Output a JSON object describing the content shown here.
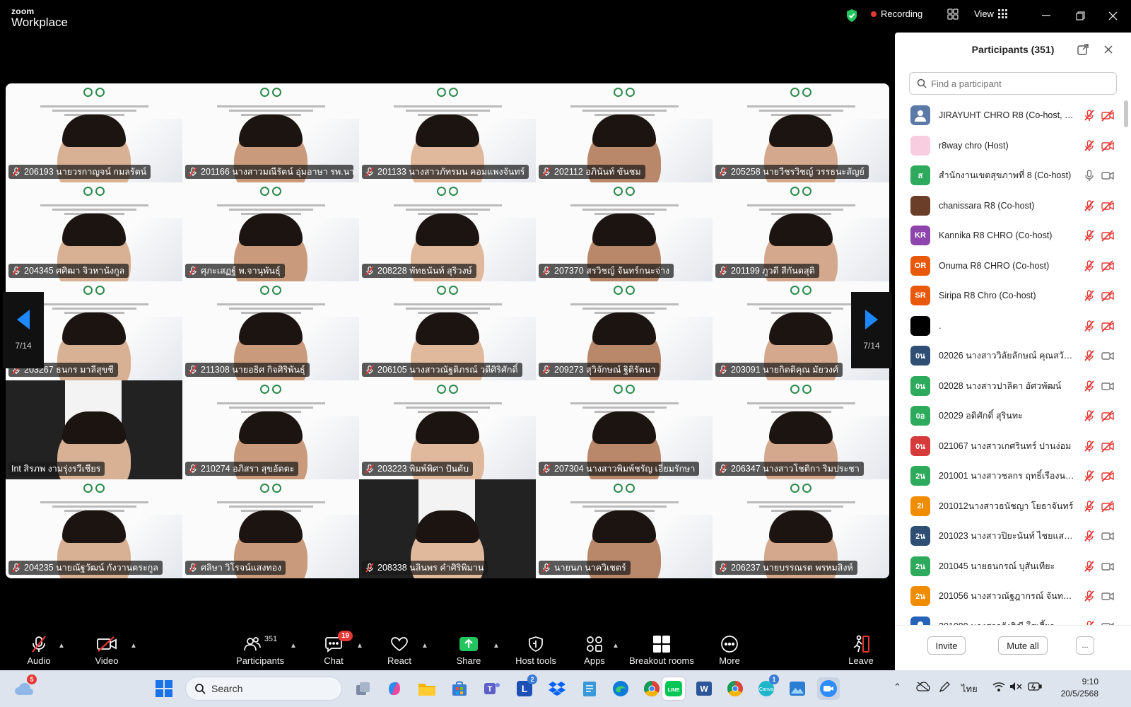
{
  "titlebar": {
    "brand_line1": "zoom",
    "brand_line2": "Workplace",
    "recording_label": "Recording",
    "view_label": "View"
  },
  "gallery": {
    "page_left": "7/14",
    "page_right": "7/14",
    "tiles": [
      {
        "name": "206193 นายวรกาญจน์ กมลรัตน์",
        "muted": true
      },
      {
        "name": "201166 นางสาวมณีรัตน์ อุ่มอาษา รพ.นา...",
        "muted": true
      },
      {
        "name": "201133 นางสาวภัทรมน คอมแพงจันทร์",
        "muted": true
      },
      {
        "name": "202112 อภินันท์ ขันชม",
        "muted": true
      },
      {
        "name": "205258 นายวีชรวิชญ์ วรรธนะสัญย์",
        "muted": true
      },
      {
        "name": "204345 ศศิฒา จิวหานังกูล",
        "muted": true
      },
      {
        "name": "ศุภะเสฏฐ์ พ.จานุพันธุ์",
        "muted": true
      },
      {
        "name": "208228 พัทธนันท์ สุริวงษ์",
        "muted": true
      },
      {
        "name": "207370 สรวิชญ์ จันทร์กนะจ่าง",
        "muted": true
      },
      {
        "name": "201199 ภูวดี สีกันดสุติ",
        "muted": true
      },
      {
        "name": "203267 ธนกร มาลีสุขชี",
        "muted": true
      },
      {
        "name": "211308 นายอธิศ กิจศิริพันธุ์",
        "muted": true
      },
      {
        "name": "206105 นางสาวณัฐติภรณ์ วดีศิริศักดิ์",
        "muted": true
      },
      {
        "name": "209273 สุวิจักษณ์ ฐิติรัตนา",
        "muted": true
      },
      {
        "name": "203091 นายกิตติคุณ มัยวงศ์",
        "muted": true
      },
      {
        "name": "Int สิรภพ งามรุ่งรวีเชียร",
        "muted": false
      },
      {
        "name": "210274 อภิสรา สุขอัตตะ",
        "muted": true
      },
      {
        "name": "203223 พิมพ์พิศา ปันตับ",
        "muted": true
      },
      {
        "name": "207304 นางสาวพิมพ์ชรัญ เอี่ยมรักษา",
        "muted": true
      },
      {
        "name": "206347 นางสาวโชติกา ริมประชา",
        "muted": true
      },
      {
        "name": "204235 นายณัฐวัฒน์ กังวานตระกูล",
        "muted": true
      },
      {
        "name": "ศลิษา วิโรจน์แสงทอง",
        "muted": true
      },
      {
        "name": "208338 นลินพร คำศิริพิมาน",
        "muted": true
      },
      {
        "name": "นายนภ นาควิเชตร์",
        "muted": true
      },
      {
        "name": "206237 นายบรรณรต พรหมสิงห์",
        "muted": true
      }
    ]
  },
  "toolbar": {
    "audio": "Audio",
    "video": "Video",
    "participants": "Participants",
    "participants_count": "351",
    "chat": "Chat",
    "chat_badge": "19",
    "react": "React",
    "share": "Share",
    "host_tools": "Host tools",
    "apps": "Apps",
    "breakout": "Breakout rooms",
    "more": "More",
    "leave": "Leave"
  },
  "panel": {
    "title": "Participants (351)",
    "search_placeholder": "Find a participant",
    "invite": "Invite",
    "mute_all": "Mute all",
    "more": "...",
    "participants": [
      {
        "initials": "",
        "name": "JIRAYUHT CHRO R8 (Co-host, me)",
        "color": "#5c7aa8",
        "mic": "off",
        "video": "off"
      },
      {
        "initials": "",
        "name": "r8way chro (Host)",
        "color": "#f9cde0",
        "mic": "off",
        "video": "off"
      },
      {
        "initials": "ส",
        "name": "สำนักงานเขตสุขภาพที่ 8 (Co-host)",
        "color": "#2eaa5c",
        "mic": "on",
        "video": "on"
      },
      {
        "initials": "",
        "name": "chanissara R8 (Co-host)",
        "color": "#6b3e2a",
        "mic": "off",
        "video": "off"
      },
      {
        "initials": "KR",
        "name": "Kannika R8 CHRO (Co-host)",
        "color": "#8e44ad",
        "mic": "off",
        "video": "off"
      },
      {
        "initials": "OR",
        "name": "Onuma R8 CHRO (Co-host)",
        "color": "#e8590c",
        "mic": "off",
        "video": "off"
      },
      {
        "initials": "SR",
        "name": "Siripa R8 Chro (Co-host)",
        "color": "#e8590c",
        "mic": "off",
        "video": "off"
      },
      {
        "initials": "",
        "name": ".",
        "color": "#000000",
        "mic": "off",
        "video": "off"
      },
      {
        "initials": "0น",
        "name": "02026 นางสาววิลัยลักษณ์ คุณสวัสดิ...",
        "color": "#2f4e73",
        "mic": "off",
        "video": "on"
      },
      {
        "initials": "0น",
        "name": "02028 นางสาวปาลิดา อัศวพัฒน์",
        "color": "#2eaa5c",
        "mic": "off",
        "video": "on"
      },
      {
        "initials": "0อ",
        "name": "02029 อดิศักดิ์ สุรินทะ",
        "color": "#2eaa5c",
        "mic": "off",
        "video": "off"
      },
      {
        "initials": "0น",
        "name": "021067 นางสาวเกศรินทร์ ปานง่อม",
        "color": "#d63a3a",
        "mic": "off",
        "video": "off"
      },
      {
        "initials": "2น",
        "name": "201001 นางสาวชลกร ฤทธิ์เรืองนาม",
        "color": "#2eaa5c",
        "mic": "off",
        "video": "off"
      },
      {
        "initials": "2I",
        "name": "201012นางสาวธนัชญา โยธาจันทร์",
        "color": "#f08c00",
        "mic": "off",
        "video": "off"
      },
      {
        "initials": "2น",
        "name": "201023 นางสาวปิยะนันท์ ไชยแสงจันทร์",
        "color": "#2f4e73",
        "mic": "off",
        "video": "on"
      },
      {
        "initials": "2น",
        "name": "201045 นายธนกรณ์ บุสันเทียะ",
        "color": "#2eaa5c",
        "mic": "off",
        "video": "on"
      },
      {
        "initials": "2น",
        "name": "201056 นางสาวณัฐฎากรณ์ จันทยุ...",
        "color": "#f08c00",
        "mic": "off",
        "video": "on"
      },
      {
        "initials": "",
        "name": "201089 นางสาวรังสิณี ใสเสี้ยว",
        "color": "#2563b8",
        "mic": "off",
        "video": "on"
      }
    ]
  },
  "taskbar": {
    "search_label": "Search",
    "weather_badge": "5",
    "teams_badge": "2",
    "app_badge": "1",
    "lang": "ไทย",
    "time": "9:10",
    "date": "20/5/2568"
  },
  "colors": {
    "accent": "#1e88ff",
    "muted_red": "#e53935",
    "share_green": "#22c55e",
    "panel_bg": "#ffffff"
  }
}
